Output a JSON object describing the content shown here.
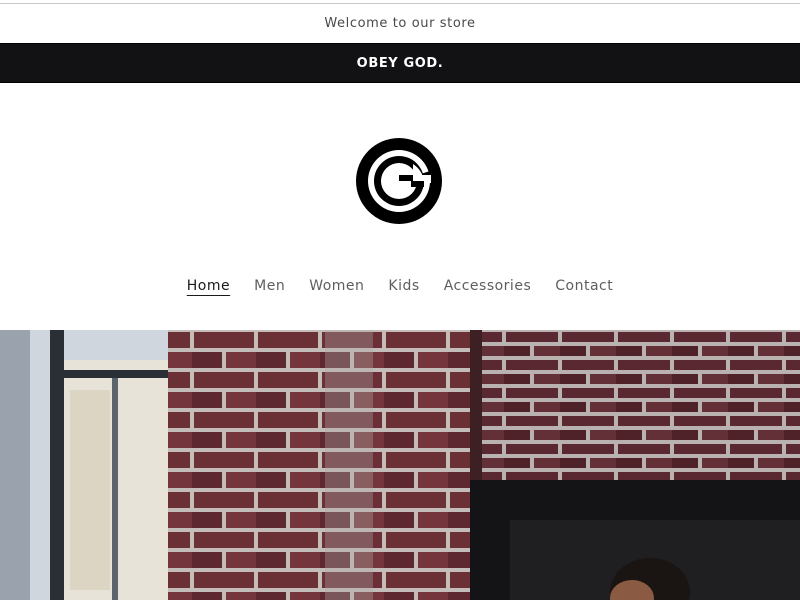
{
  "welcome": {
    "text": "Welcome to our store"
  },
  "announcement": {
    "text": "OBEY GOD."
  },
  "logo": {
    "icon": "g-circle-logo",
    "color": "#000000"
  },
  "nav": {
    "items": [
      {
        "label": "Home",
        "active": true
      },
      {
        "label": "Men",
        "active": false
      },
      {
        "label": "Women",
        "active": false
      },
      {
        "label": "Kids",
        "active": false
      },
      {
        "label": "Accessories",
        "active": false
      },
      {
        "label": "Contact",
        "active": false
      }
    ]
  },
  "hero": {
    "image": "brick-wall-with-window-and-person"
  },
  "colors": {
    "announce_bg": "#121214",
    "brick": "#6b2f36",
    "mortar": "#c9c2c0"
  }
}
